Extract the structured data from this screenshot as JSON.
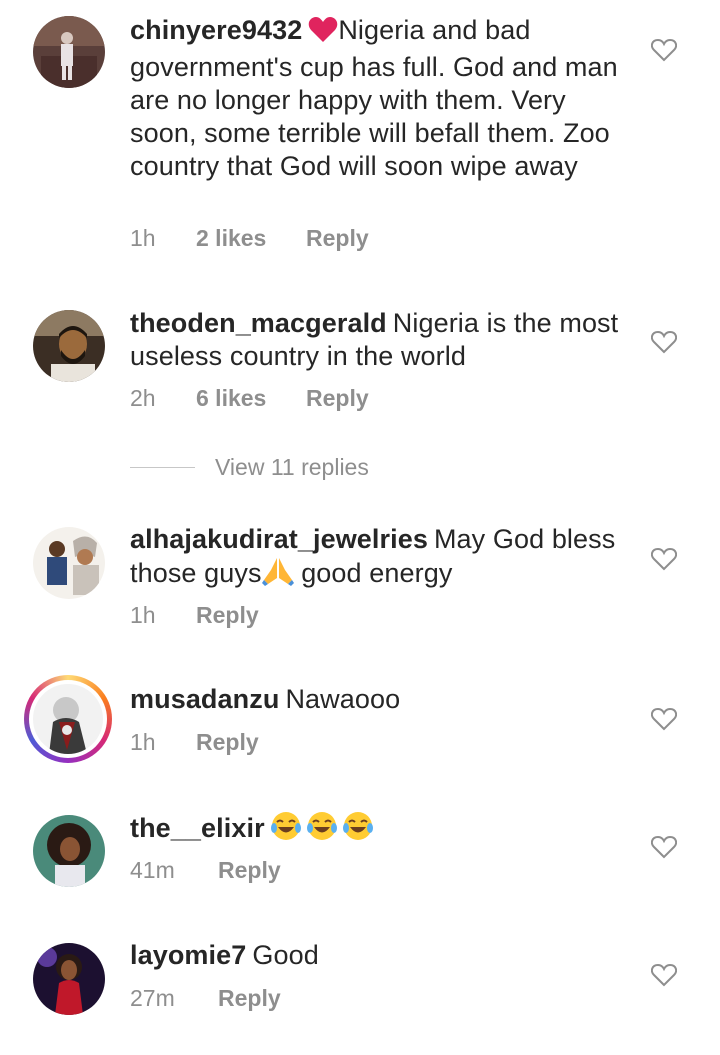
{
  "comments": [
    {
      "username": "chinyere9432",
      "text_emoji": "heart",
      "text": "Nigeria and bad government's cup has full. God and man are no longer happy with them. Very soon, some terrible will befall them. Zoo country that God will soon wipe away",
      "time": "1h",
      "likes": "2 likes",
      "reply": "Reply"
    },
    {
      "username": "theoden_macgerald",
      "text": "Nigeria is the most useless country in the world",
      "time": "2h",
      "likes": "6 likes",
      "reply": "Reply"
    },
    {
      "username": "alhajakudirat_jewelries",
      "text_before": "May God bless those guys",
      "text_emoji": "folded-hands",
      "text_after": " good energy",
      "time": "1h",
      "reply": "Reply"
    },
    {
      "username": "musadanzu",
      "text": "Nawaooo",
      "time": "1h",
      "reply": "Reply"
    },
    {
      "username": "the__elixir",
      "text_emoji": "tears-of-joy x3",
      "time": "41m",
      "reply": "Reply"
    },
    {
      "username": "layomie7",
      "text": "Good",
      "time": "27m",
      "reply": "Reply"
    }
  ],
  "view_replies": "View 11 replies",
  "colors": {
    "text": "#262626",
    "muted": "#8e8e8e",
    "heart_emoji": "#e0245e",
    "story_ring": "#d62976"
  },
  "icons": {
    "like": "heart-outline-icon"
  }
}
